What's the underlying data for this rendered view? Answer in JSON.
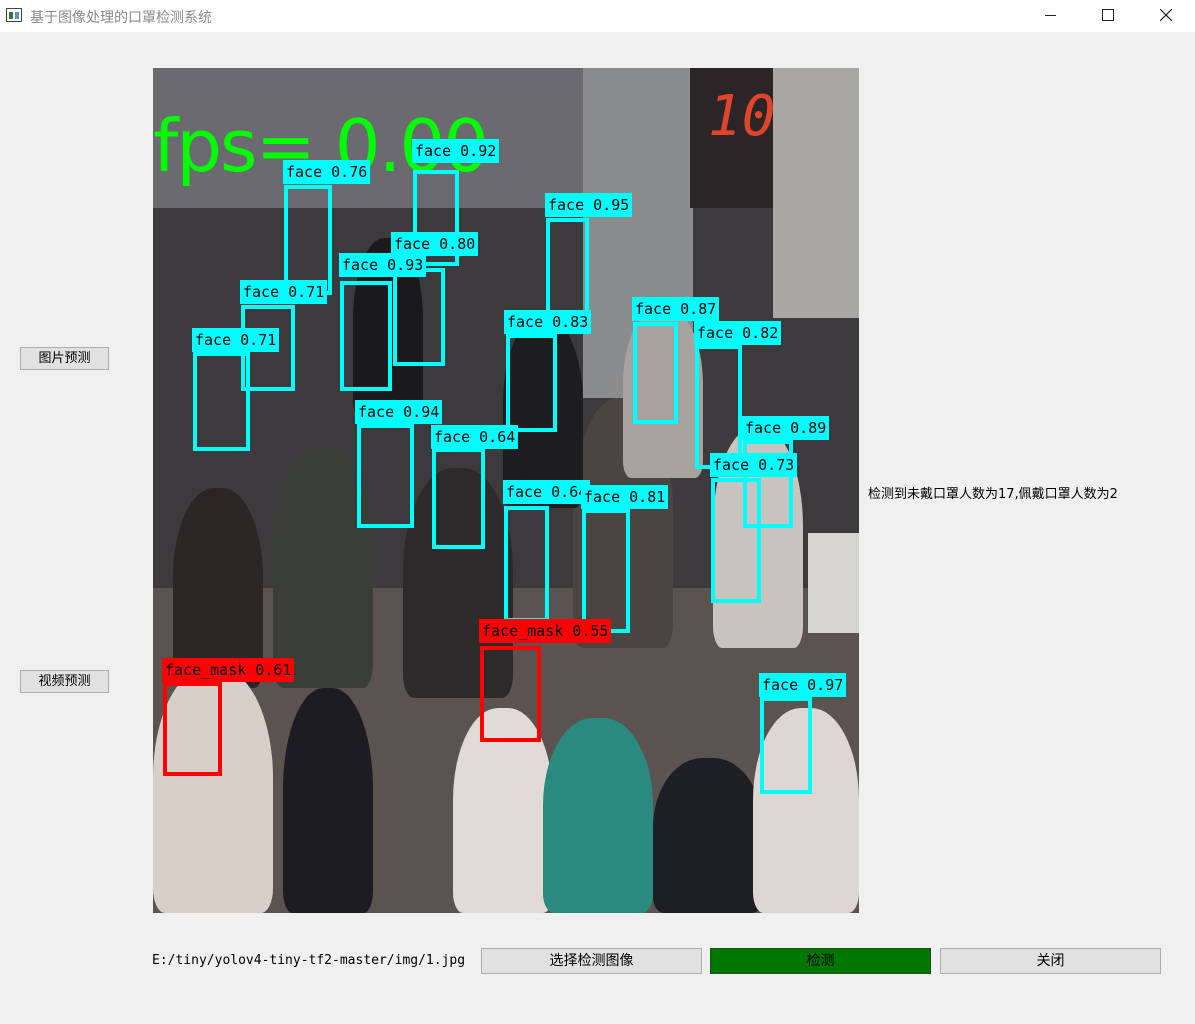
{
  "window": {
    "title": "基于图像处理的口罩检测系统",
    "icon": "app-window-icon"
  },
  "side": {
    "image_predict": "图片预测",
    "video_predict": "视频预测"
  },
  "viewer": {
    "fps_text": "fps= 0.00",
    "sign_text": "10",
    "detections": [
      {
        "label": "face 0.92",
        "class": "face"
      },
      {
        "label": "face 0.76",
        "class": "face"
      },
      {
        "label": "face 0.80",
        "class": "face"
      },
      {
        "label": "face 0.93",
        "class": "face"
      },
      {
        "label": "face 0.95",
        "class": "face"
      },
      {
        "label": "face 0.71",
        "class": "face"
      },
      {
        "label": "face 0.71",
        "class": "face"
      },
      {
        "label": "face 0.83",
        "class": "face"
      },
      {
        "label": "face 0.87",
        "class": "face"
      },
      {
        "label": "face 0.82",
        "class": "face"
      },
      {
        "label": "face 0.94",
        "class": "face"
      },
      {
        "label": "face 0.64",
        "class": "face"
      },
      {
        "label": "face 0.89",
        "class": "face"
      },
      {
        "label": "face 0.73",
        "class": "face"
      },
      {
        "label": "face 0.64",
        "class": "face"
      },
      {
        "label": "face 0.81",
        "class": "face"
      },
      {
        "label": "face_mask 0.55",
        "class": "face_mask"
      },
      {
        "label": "face_mask 0.61",
        "class": "face_mask"
      },
      {
        "label": "face 0.97",
        "class": "face"
      }
    ]
  },
  "status": {
    "result_text": "检测到未戴口罩人数为17,佩戴口罩人数为2"
  },
  "bottom": {
    "path": "E:/tiny/yolov4-tiny-tf2-master/img/1.jpg",
    "select_label": "选择检测图像",
    "detect_label": "检测",
    "close_label": "关闭"
  },
  "colors": {
    "face_box": "#00ffff",
    "mask_box": "#ff0000",
    "fps": "#00ff00",
    "detect_button": "#007800"
  }
}
